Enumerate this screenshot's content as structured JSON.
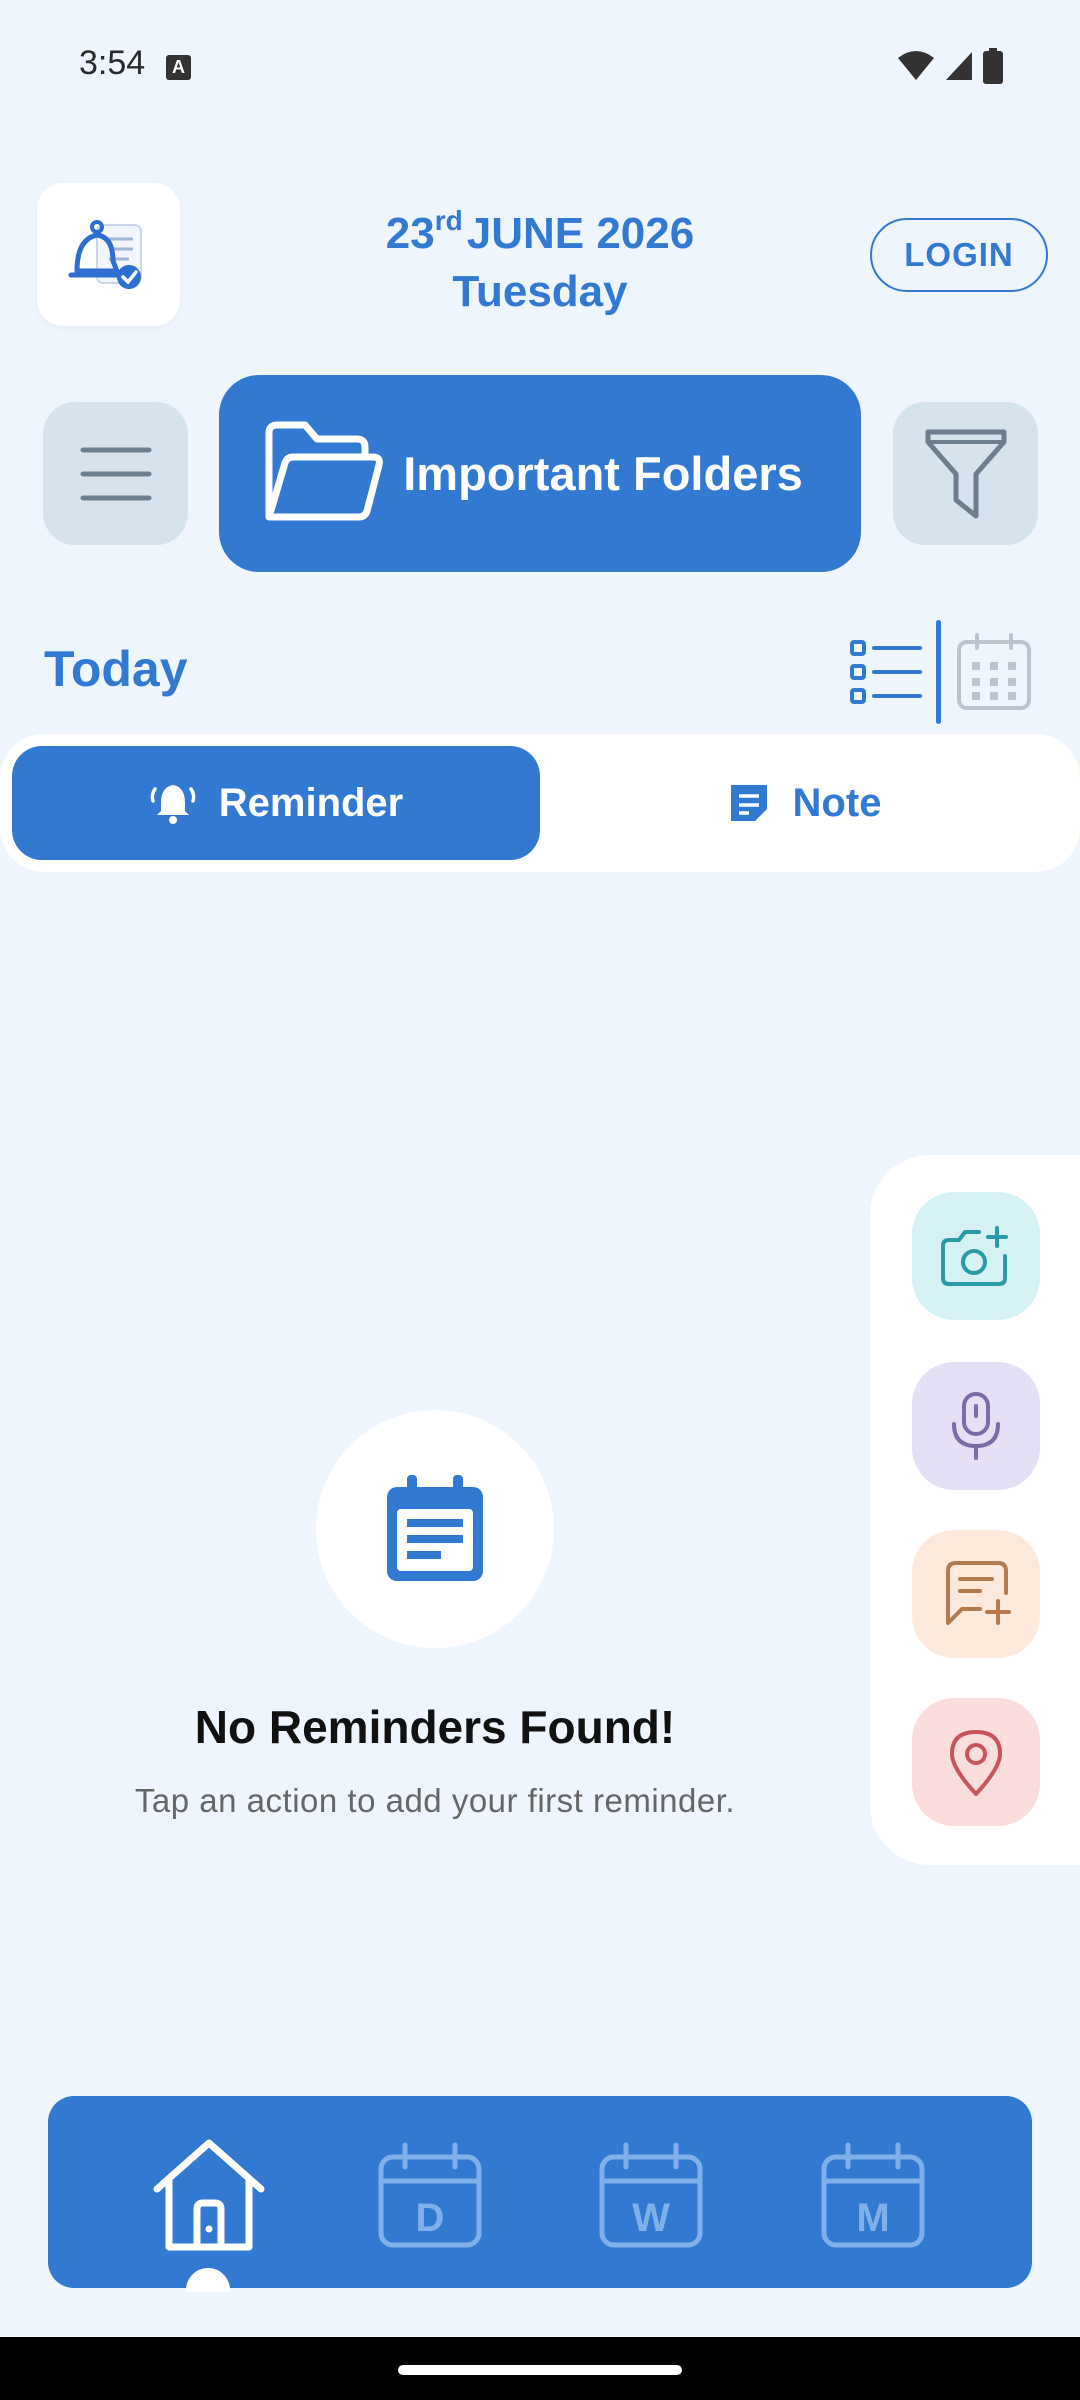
{
  "status_bar": {
    "time": "3:54",
    "notification_icon": "A"
  },
  "header": {
    "date_day": "23",
    "date_suffix": "rd",
    "date_rest": "JUNE 2026",
    "weekday": "Tuesday",
    "login_label": "LOGIN"
  },
  "actions": {
    "folders_label": "Important Folders"
  },
  "section": {
    "title": "Today"
  },
  "tabs": {
    "reminder_label": "Reminder",
    "note_label": "Note"
  },
  "empty_state": {
    "title": "No Reminders Found!",
    "subtitle": "Tap an action to add your first reminder."
  },
  "bottom_nav": {
    "day_letter": "D",
    "week_letter": "W",
    "month_letter": "M"
  },
  "colors": {
    "accent": "#3179d1",
    "background": "#eef5fc"
  }
}
